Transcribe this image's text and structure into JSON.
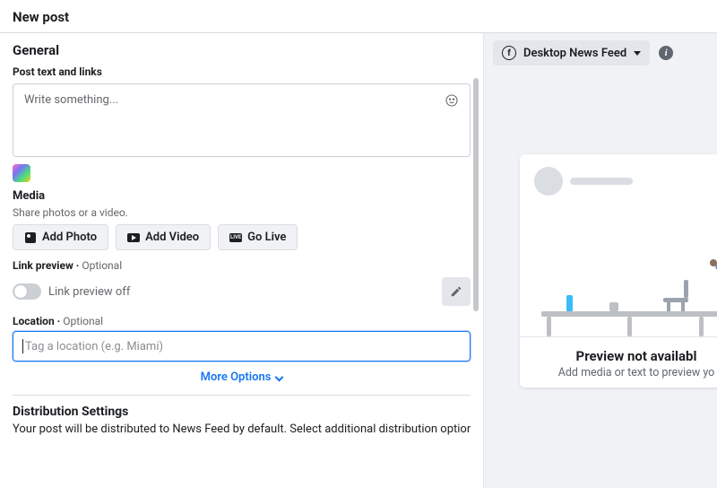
{
  "header": {
    "title": "New post"
  },
  "general": {
    "title": "General",
    "postTextLabel": "Post text and links",
    "postTextPlaceholder": "Write something..."
  },
  "media": {
    "title": "Media",
    "subtitle": "Share photos or a video.",
    "addPhoto": "Add Photo",
    "addVideo": "Add Video",
    "goLive": "Go Live"
  },
  "linkPreview": {
    "label": "Link preview",
    "optional": "Optional",
    "status": "Link preview off"
  },
  "location": {
    "label": "Location",
    "optional": "Optional",
    "placeholder": "Tag a location (e.g. Miami)"
  },
  "more": {
    "label": "More Options"
  },
  "distribution": {
    "title": "Distribution Settings",
    "text": "Your post will be distributed to News Feed by default. Select additional distribution options below."
  },
  "preview": {
    "feedSelector": "Desktop News Feed",
    "notAvailableTitle": "Preview not availabl",
    "notAvailableSub": "Add media or text to preview yo"
  }
}
